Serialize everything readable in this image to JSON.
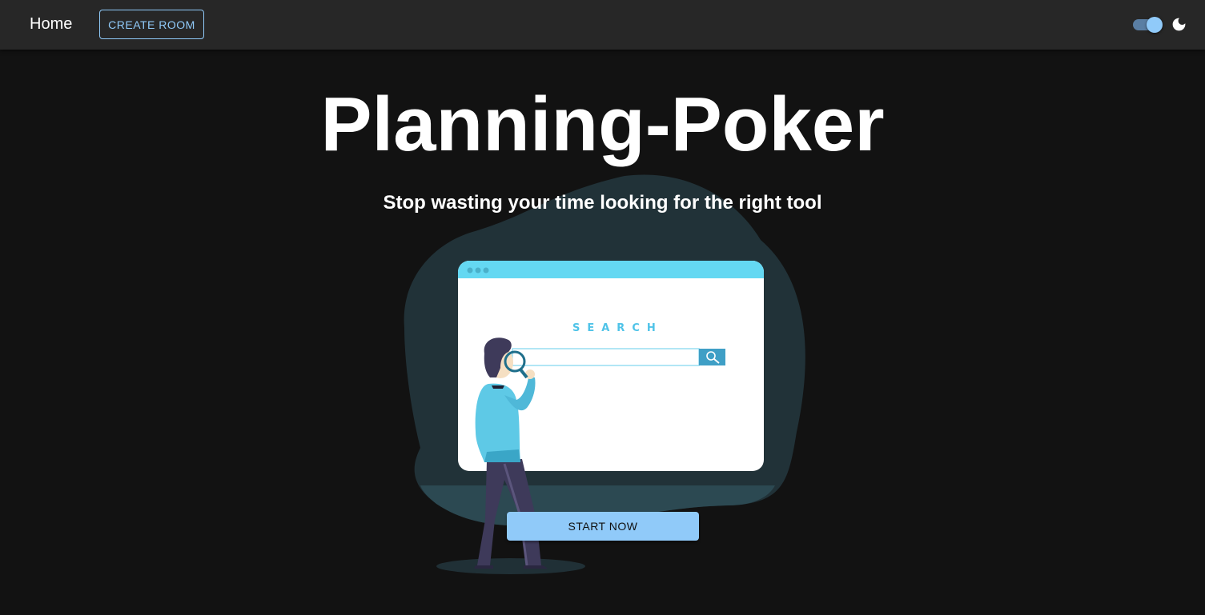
{
  "appbar": {
    "home_label": "Home",
    "create_room_label": "CREATE ROOM",
    "theme_toggle_on": true,
    "theme_icon": "moon-icon"
  },
  "hero": {
    "title": "Planning-Poker",
    "subtitle": "Stop wasting your time looking for the right tool",
    "illustration": {
      "search_text": "SEARCH",
      "icons": [
        "search-icon",
        "magnifying-glass-icon"
      ]
    },
    "cta_label": "START NOW"
  },
  "colors": {
    "background": "#121212",
    "appbar": "#272727",
    "primary": "#90caf9",
    "blob": "#213238",
    "browser_header": "#64d8f2"
  }
}
